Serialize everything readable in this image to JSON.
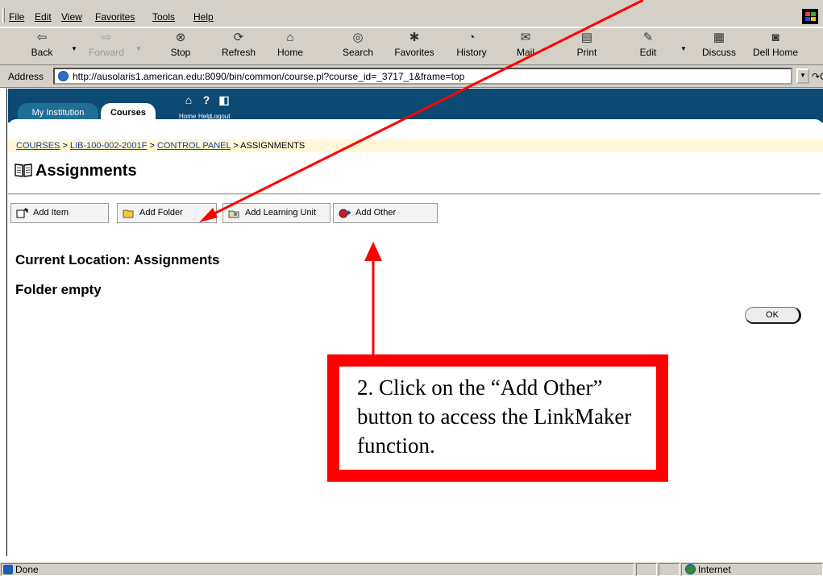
{
  "menu": {
    "items": [
      {
        "label": "File"
      },
      {
        "label": "Edit"
      },
      {
        "label": "View"
      },
      {
        "label": "Favorites"
      },
      {
        "label": "Tools"
      },
      {
        "label": "Help"
      }
    ]
  },
  "toolbar": {
    "buttons": [
      {
        "label": "Back",
        "icon": "back-arrow-icon"
      },
      {
        "label": "Forward",
        "icon": "forward-arrow-icon"
      },
      {
        "label": "Stop",
        "icon": "stop-icon"
      },
      {
        "label": "Refresh",
        "icon": "refresh-icon"
      },
      {
        "label": "Home",
        "icon": "home-icon"
      },
      {
        "label": "Search",
        "icon": "search-icon"
      },
      {
        "label": "Favorites",
        "icon": "favorites-icon"
      },
      {
        "label": "History",
        "icon": "history-icon"
      },
      {
        "label": "Mail",
        "icon": "mail-icon"
      },
      {
        "label": "Print",
        "icon": "print-icon"
      },
      {
        "label": "Edit",
        "icon": "edit-icon"
      },
      {
        "label": "Discuss",
        "icon": "discuss-icon"
      },
      {
        "label": "Dell Home",
        "icon": "dell-home-icon"
      }
    ]
  },
  "address": {
    "label": "Address",
    "url": "http://ausolaris1.american.edu:8090/bin/common/course.pl?course_id=_3717_1&frame=top",
    "go_label": "Go"
  },
  "bb": {
    "tabs": [
      {
        "label": "My Institution"
      },
      {
        "label": "Courses"
      }
    ],
    "icons": [
      {
        "label": "Home",
        "icon": "home-icon"
      },
      {
        "label": "Help",
        "icon": "help-icon"
      },
      {
        "label": "Logout",
        "icon": "logout-icon"
      }
    ]
  },
  "breadcrumb": {
    "links": [
      "COURSES",
      "LIB-100-002-2001F",
      "CONTROL PANEL"
    ],
    "current": "ASSIGNMENTS",
    "separator": ">"
  },
  "page": {
    "title": "Assignments",
    "current_location": "Current Location: Assignments",
    "folder_status": "Folder empty",
    "ok_label": "OK"
  },
  "actions": {
    "buttons": [
      {
        "label": "Add Item"
      },
      {
        "label": "Add Folder"
      },
      {
        "label": "Add Learning Unit"
      },
      {
        "label": "Add Other"
      }
    ]
  },
  "annotation": {
    "text": "2.  Click on the “Add Other” button to access the LinkMaker function.",
    "color": "#ff0000"
  },
  "status": {
    "text": "Done",
    "zone": "Internet"
  },
  "colors": {
    "chrome": "#d4d0c8",
    "bb_header": "#0c4a74",
    "breadcrumb_bg": "#fff7d8",
    "link": "#1c3f9a",
    "annotation": "#ff0000"
  }
}
